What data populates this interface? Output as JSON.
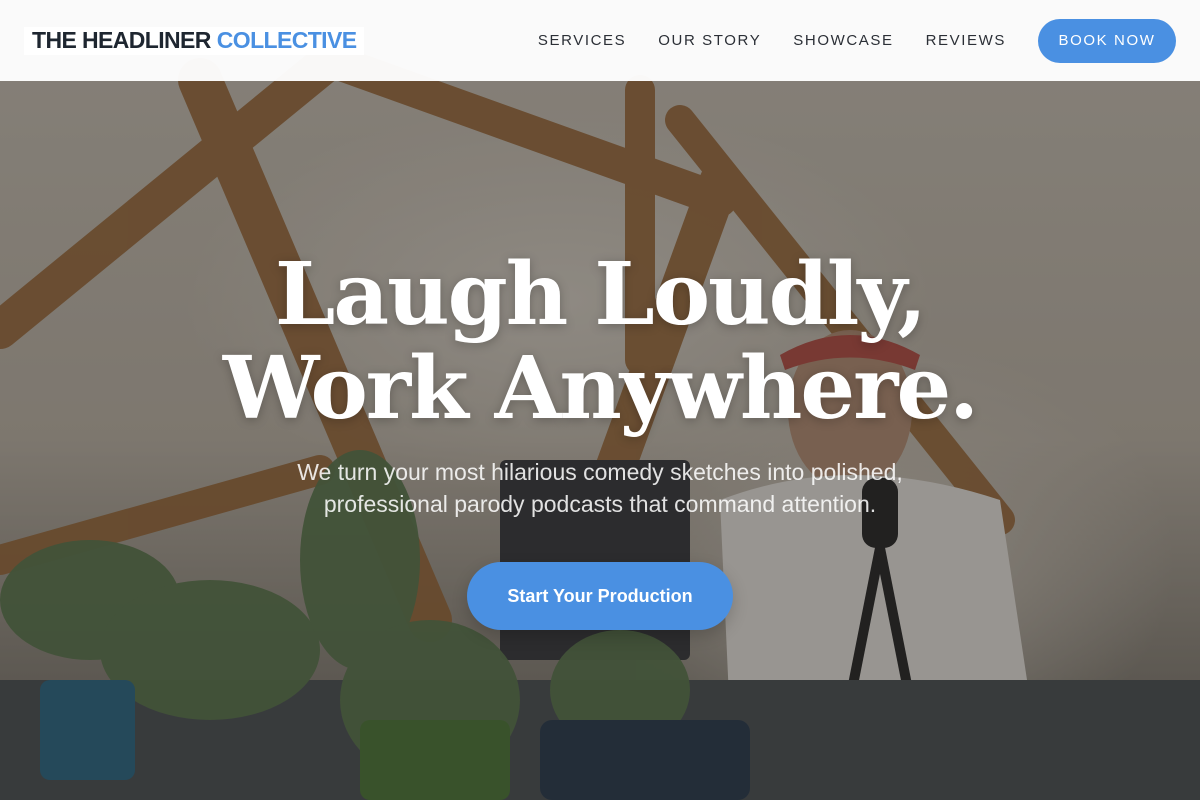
{
  "header": {
    "logo_primary": "THE HEADLINER",
    "logo_accent": "COLLECTIVE",
    "nav": [
      {
        "label": "SERVICES"
      },
      {
        "label": "OUR STORY"
      },
      {
        "label": "SHOWCASE"
      },
      {
        "label": "REVIEWS"
      }
    ],
    "cta_label": "BOOK NOW"
  },
  "hero": {
    "title_line1": "Laugh Loudly,",
    "title_line2": "Work Anywhere.",
    "subtitle": "We turn your most hilarious comedy sketches into polished, professional parody podcasts that command attention.",
    "cta_label": "Start Your Production",
    "background": "podcast-studio-photo"
  },
  "colors": {
    "accent": "#4a90e2",
    "header_bg": "#ffffff",
    "logo_text": "#1e2630",
    "hero_text": "#ffffff"
  }
}
